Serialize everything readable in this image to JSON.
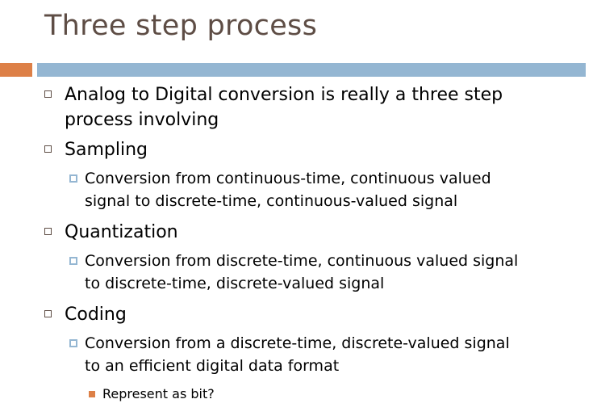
{
  "slide": {
    "title": "Three step process",
    "accent_colors": {
      "orange": "#dd8047",
      "blue": "#94b6d2",
      "title": "#5e4d45"
    },
    "bullets": [
      {
        "text_line1": "Analog to Digital conversion is really a three step",
        "text_line2": "process involving"
      },
      {
        "text": "Sampling",
        "sub": {
          "line1": "Conversion from continuous-time, continuous valued",
          "line2": "signal to discrete-time, continuous-valued signal"
        }
      },
      {
        "text": "Quantization",
        "sub": {
          "line1": "Conversion from discrete-time, continuous valued signal",
          "line2": "to discrete-time, discrete-valued signal"
        }
      },
      {
        "text": "Coding",
        "sub": {
          "line1": "Conversion from a discrete-time, discrete-valued signal",
          "line2": "to an efficient digital data format"
        },
        "subsub": "Represent as bit?"
      }
    ]
  }
}
